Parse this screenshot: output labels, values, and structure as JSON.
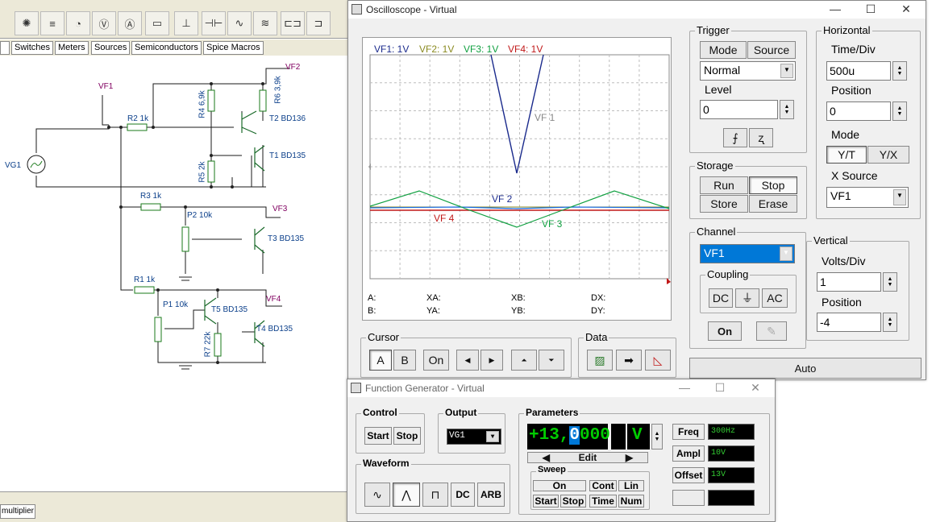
{
  "tabs": [
    "Switches",
    "Meters",
    "Sources",
    "Semiconductors",
    "Spice Macros"
  ],
  "statusbar": {
    "tab": "multiplier"
  },
  "circuit": {
    "labels": [
      "VF1",
      "VF2",
      "VF3",
      "VF4",
      "VG1",
      "R2 1k",
      "R3 1k",
      "R1 1k",
      "R4 6,9k",
      "R6 3,9k",
      "T2 BD136",
      "T1 BD135",
      "R5 2k",
      "P2 10k",
      "T3 BD135",
      "P1 10k",
      "T5 BD135",
      "T4 BD135",
      "R7 22k"
    ]
  },
  "scope": {
    "title": "Oscilloscope - Virtual",
    "legend": [
      {
        "name": "VF1: 1V",
        "color": "#1a2a8c"
      },
      {
        "name": "VF2: 1V",
        "color": "#8a8a20"
      },
      {
        "name": "VF3: 1V",
        "color": "#10a040"
      },
      {
        "name": "VF4: 1V",
        "color": "#c01818"
      }
    ],
    "trace_labels": [
      "VF 1",
      "VF 2",
      "VF 3",
      "VF 4"
    ],
    "readouts": {
      "a": "A:",
      "b": "B:",
      "xa": "XA:",
      "ya": "YA:",
      "xb": "XB:",
      "yb": "YB:",
      "dx": "DX:",
      "dy": "DY:"
    },
    "trigger": {
      "title": "Trigger",
      "mode": "Mode",
      "source": "Source",
      "mode_value": "Normal",
      "level_label": "Level",
      "level_value": "0"
    },
    "storage": {
      "title": "Storage",
      "run": "Run",
      "stop": "Stop",
      "store": "Store",
      "erase": "Erase"
    },
    "horizontal": {
      "title": "Horizontal",
      "timediv_label": "Time/Div",
      "timediv_value": "500u",
      "position_label": "Position",
      "position_value": "0",
      "mode_label": "Mode",
      "yt": "Y/T",
      "yx": "Y/X",
      "xsource_label": "X Source",
      "xsource_value": "VF1"
    },
    "channel": {
      "title": "Channel",
      "value": "VF1",
      "coupling": "Coupling",
      "dc": "DC",
      "ground": "⏚",
      "ac": "AC",
      "on": "On"
    },
    "vertical": {
      "title": "Vertical",
      "voltsdiv_label": "Volts/Div",
      "voltsdiv_value": "1",
      "position_label": "Position",
      "position_value": "-4"
    },
    "cursor": {
      "title": "Cursor",
      "a": "A",
      "b": "B",
      "on": "On"
    },
    "data": {
      "title": "Data"
    },
    "auto": "Auto"
  },
  "fg": {
    "title": "Function Generator - Virtual",
    "control": {
      "title": "Control",
      "start": "Start",
      "stop": "Stop"
    },
    "output": {
      "title": "Output",
      "value": "VG1"
    },
    "waveform": {
      "title": "Waveform",
      "dc": "DC",
      "arb": "ARB"
    },
    "parameters": {
      "title": "Parameters",
      "display_pre": "+13,",
      "display_cursor": "0",
      "display_post": "000",
      "unit": "V",
      "edit": "Edit"
    },
    "sweep": {
      "title": "Sweep",
      "on": "On",
      "cont": "Cont",
      "lin": "Lin",
      "start": "Start",
      "stop": "Stop",
      "time": "Time",
      "num": "Num"
    },
    "freq": {
      "label": "Freq",
      "value": "300Hz"
    },
    "ampl": {
      "label": "Ampl",
      "value": "10V"
    },
    "offset": {
      "label": "Offset",
      "value": "13V"
    }
  }
}
